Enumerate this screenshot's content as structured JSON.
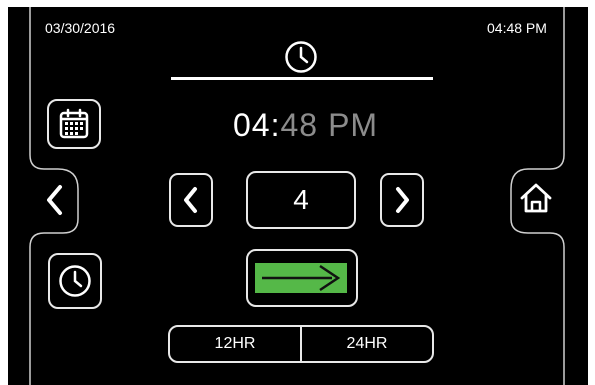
{
  "status_bar": {
    "date": "03/30/2016",
    "time": "04:48 PM"
  },
  "clock_display": {
    "hour": "04:",
    "minute": "48",
    "ampm": "PM"
  },
  "hour_selector": {
    "value": "4"
  },
  "format_toggle": {
    "option_12": "12HR",
    "option_24": "24HR"
  },
  "colors": {
    "background": "#000000",
    "foreground": "#ffffff",
    "dim_text": "#8c8c8c",
    "accent_green": "#55b848"
  },
  "icons": [
    "clock-icon",
    "calendar-icon",
    "back-arrow-icon",
    "home-icon",
    "chevron-left-icon",
    "chevron-right-icon",
    "confirm-arrow-icon"
  ]
}
